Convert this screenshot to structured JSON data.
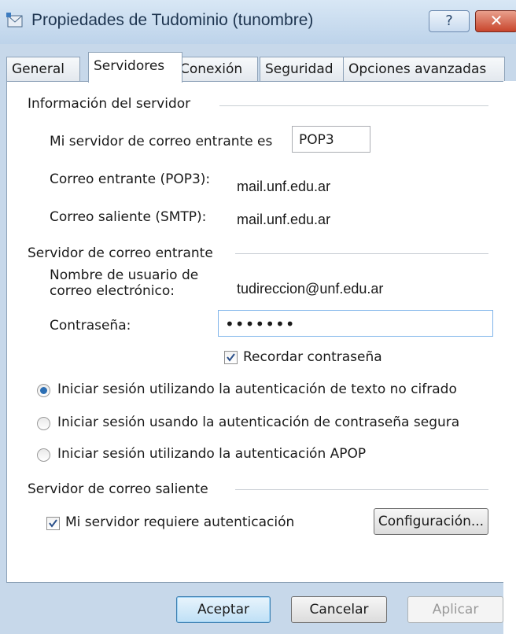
{
  "window": {
    "title": "Propiedades de Tudominio (tunombre)",
    "help_label": "?",
    "close_label": "✕"
  },
  "tabs": [
    {
      "label": "General"
    },
    {
      "label": "Servidores"
    },
    {
      "label": "Conexión"
    },
    {
      "label": "Seguridad"
    },
    {
      "label": "Opciones avanzadas"
    }
  ],
  "server_info": {
    "title": "Información del servidor",
    "incoming_type_label": "Mi servidor de correo entrante es",
    "incoming_type_value": "POP3",
    "incoming_label": "Correo entrante (POP3):",
    "incoming_value": "mail.unf.edu.ar",
    "outgoing_label": "Correo saliente (SMTP):",
    "outgoing_value": "mail.unf.edu.ar"
  },
  "incoming_server": {
    "title": "Servidor de correo entrante",
    "username_label_line1": "Nombre de usuario de",
    "username_label_line2": "correo electrónico:",
    "username_value": "tudireccion@unf.edu.ar",
    "password_label": "Contraseña:",
    "password_value": "•••••••",
    "remember_label": "Recordar contraseña",
    "auth_options": [
      {
        "label": "Iniciar sesión utilizando la autenticación de texto no cifrado",
        "selected": true
      },
      {
        "label": "Iniciar sesión usando la autenticación de contraseña segura",
        "selected": false
      },
      {
        "label": "Iniciar sesión utilizando la autenticación APOP",
        "selected": false
      }
    ]
  },
  "outgoing_server": {
    "title": "Servidor de correo saliente",
    "requires_auth_label": "Mi servidor requiere autenticación",
    "settings_button": "Configuración..."
  },
  "footer": {
    "ok": "Aceptar",
    "cancel": "Cancelar",
    "apply": "Aplicar"
  }
}
